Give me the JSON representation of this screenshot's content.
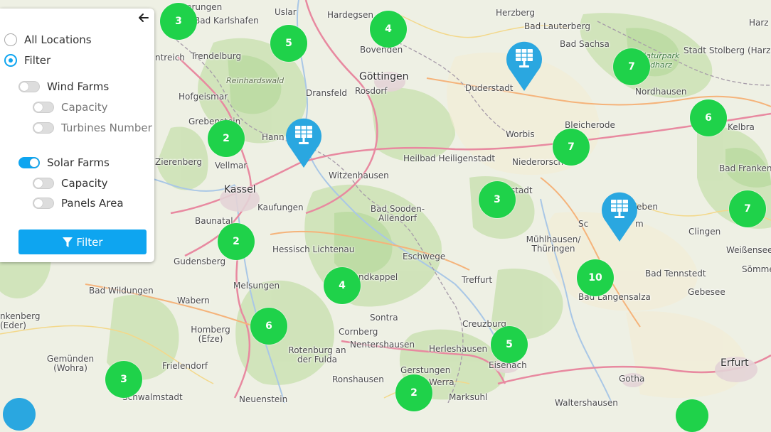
{
  "panel": {
    "radio_all": "All Locations",
    "radio_filter": "Filter",
    "wind_farms": "Wind Farms",
    "wind_capacity": "Capacity",
    "wind_turbines": "Turbines Number",
    "solar_farms": "Solar Farms",
    "solar_capacity": "Capacity",
    "solar_panels": "Panels Area",
    "filter_button": "Filter",
    "selected_radio": "Filter",
    "wind_enabled": false,
    "solar_enabled": true
  },
  "clusters": [
    "3",
    "5",
    "4",
    "7",
    "6",
    "2",
    "7",
    "3",
    "7",
    "2",
    "10",
    "4",
    "6",
    "5",
    "3",
    "2"
  ],
  "solar_markers": 3,
  "places": {
    "p1": "Bad Karlshafen",
    "p2": "Uslar",
    "p3": "Hardegsen",
    "p4": "Herzberg",
    "p5": "Bad Lauterberg",
    "p6": "Bad Sachsa",
    "p7": "Stadt Stolberg (Harz)",
    "p8": "Trendelburg",
    "p9": "Reinhardswald",
    "p10": "Bovenden",
    "p11": "Göttingen",
    "p12": "Dransfeld",
    "p13": "Rosdorf",
    "p14": "Duderstadt",
    "p15": "Nordhausen",
    "p16": "Hofgeismar",
    "p17": "Grebenstein",
    "p18": "Worbis",
    "p19": "Bleicherode",
    "p20": "Kelbra",
    "p21": "Zierenberg",
    "p22": "Vellmar",
    "p23": "Witzenhausen",
    "p24": "Heilbad Heiligenstadt",
    "p25": "Niederorschel",
    "p26": "Bad Franken",
    "p27": "Kassel",
    "p28": "Kaufungen",
    "p29": "Bad Sooden-Allendorf",
    "p30": "Baunatal",
    "p31": "Hessisch Lichtenau",
    "p32": "Mühlhausen/ Thüringen",
    "p33": "Clingen",
    "p34": "Weißensee",
    "p35": "Gudensberg",
    "p36": "Eschwege",
    "p37": "Sömme",
    "p38": "Bad Wildungen",
    "p39": "Melsungen",
    "p40": "Treffurt",
    "p41": "Bad Tennstedt",
    "p42": "Wabern",
    "p43": "Bad Langensalza",
    "p44": "Gebesee",
    "p45": "Sontra",
    "p46": "Homberg (Efze)",
    "p47": "Cornberg",
    "p48": "Creuzburg",
    "p49": "Nentershausen",
    "p50": "Herleshausen",
    "p51": "Rotenburg an der Fulda",
    "p52": "Eisenach",
    "p53": "Gemünden (Wohra)",
    "p54": "Frielendorf",
    "p55": "Gerstungen",
    "p56": "Ronshausen",
    "p57": "Werra",
    "p58": "Gotha",
    "p59": "Erfurt",
    "p60": "Schwalmstadt",
    "p61": "Neuenstein",
    "p62": "Marksuhl",
    "p63": "nkenberg (Eder)",
    "p64": "Naturpark Südharz",
    "p65": "ntreich",
    "p66": "Hann",
    "p67": "ndkappel",
    "p68": "stadt",
    "p69": "eben",
    "p70": "Sc",
    "p71": "m",
    "p72": "verungen",
    "p73": "Harz",
    "p74": "Waltershausen"
  },
  "colors": {
    "accent": "#0ea5f0",
    "cluster": "#1fd24a",
    "marker": "#2aa7e0"
  }
}
